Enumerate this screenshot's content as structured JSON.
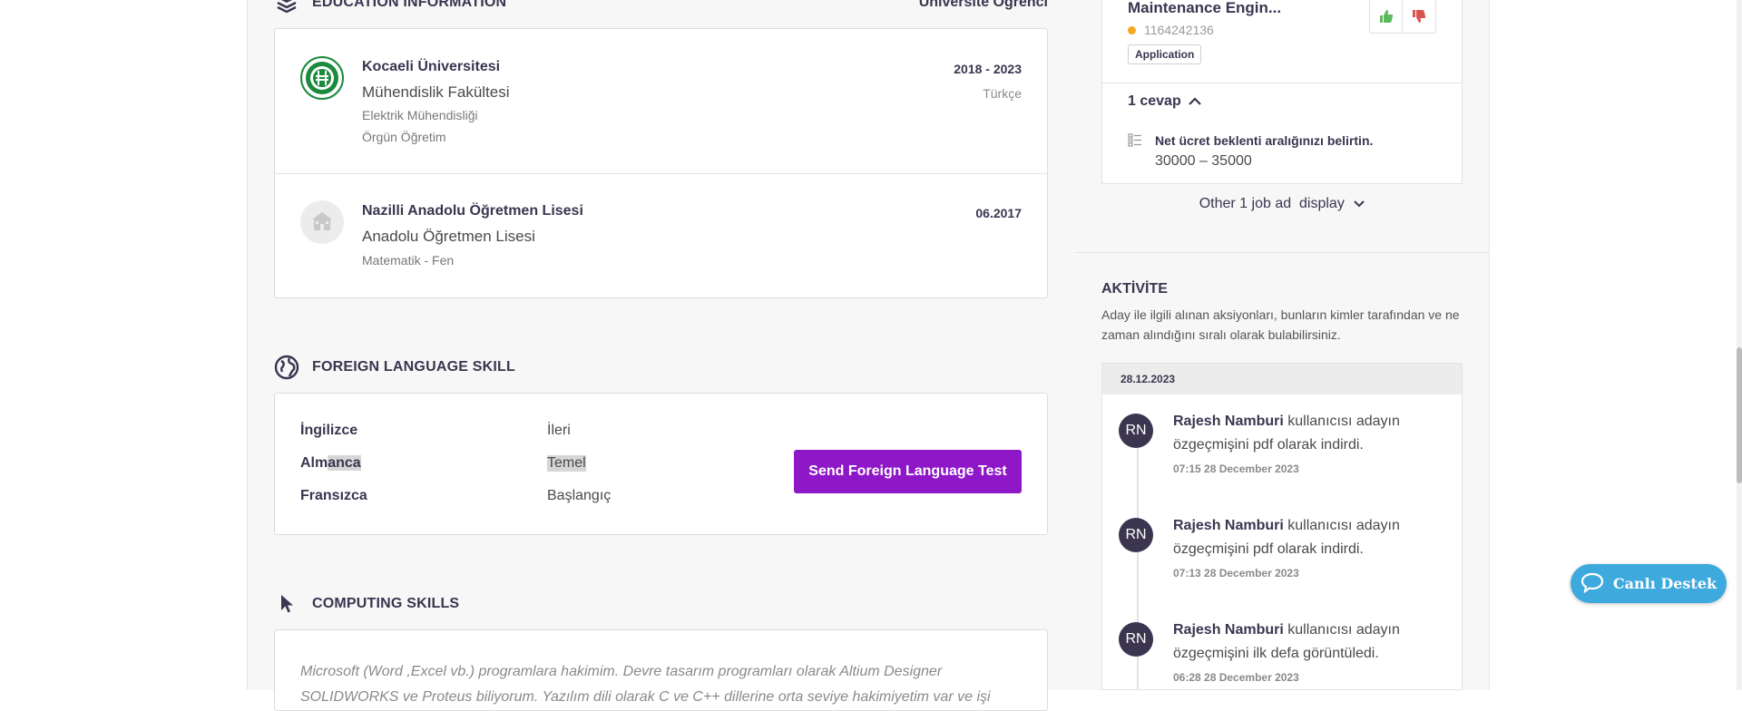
{
  "education": {
    "title": "EDUCATION INFORMATION",
    "status": "Üniversite Öğrenci",
    "items": [
      {
        "school": "Kocaeli Üniversitesi",
        "faculty": "Mühendislik Fakültesi",
        "department": "Elektrik Mühendisliği",
        "program": "Örgün Öğretim",
        "dates": "2018 - 2023",
        "language": "Türkçe"
      },
      {
        "school": "Nazilli Anadolu Öğretmen Lisesi",
        "faculty": "Anadolu Öğretmen Lisesi",
        "department": "Matematik - Fen",
        "dates": "06.2017"
      }
    ]
  },
  "languages": {
    "title": "FOREIGN LANGUAGE SKILL",
    "rows": [
      {
        "name_a": "İngilizce",
        "name_b": "",
        "level": "İleri"
      },
      {
        "name_a": "Alm",
        "name_b": "anca",
        "level": "Temel"
      },
      {
        "name_a": "Fransızca",
        "name_b": "",
        "level": "Başlangıç"
      }
    ],
    "button": "Send Foreign Language Test"
  },
  "computing": {
    "title": "COMPUTING SKILLS",
    "line1": "Microsoft (Word ,Excel vb.) programlara hakimim. Devre tasarım programları olarak Altium Designer",
    "line2": "SOLIDWORKS ve Proteus biliyorum. Yazılım dili olarak C ve C++ dillerine orta seviye hakimiyetim var ve işi"
  },
  "job": {
    "title": "Maintenance Engin...",
    "id": "1164242136",
    "tag": "Application",
    "answers_label": "1 cevap",
    "question": "Net ücret beklenti aralığınızı belirtin.",
    "answer": "30000 – 35000",
    "other_label": "Other 1 job ad",
    "display_label": "display"
  },
  "activity": {
    "title": "AKTİVİTE",
    "description": "Aday ile ilgili alınan aksiyonları, bunların kimler tarafından ve ne zaman alındığını sıralı olarak bulabilirsiniz.",
    "date": "28.12.2023",
    "items": [
      {
        "initials": "RN",
        "user": "Rajesh Namburi",
        "text": " kullanıcısı adayın özgeçmişini pdf olarak indirdi.",
        "time": "07:15 28 December 2023"
      },
      {
        "initials": "RN",
        "user": "Rajesh Namburi",
        "text": " kullanıcısı adayın özgeçmişini pdf olarak indirdi.",
        "time": "07:13 28 December 2023"
      },
      {
        "initials": "RN",
        "user": "Rajesh Namburi",
        "text": " kullanıcısı adayın özgeçmişini ilk defa görüntüledi.",
        "time": "06:28 28 December 2023"
      }
    ]
  },
  "support": {
    "label": "Canlı Destek"
  },
  "colors": {
    "accent": "#8e17c7",
    "support": "#3ea9dd",
    "dark": "#3b3550"
  }
}
